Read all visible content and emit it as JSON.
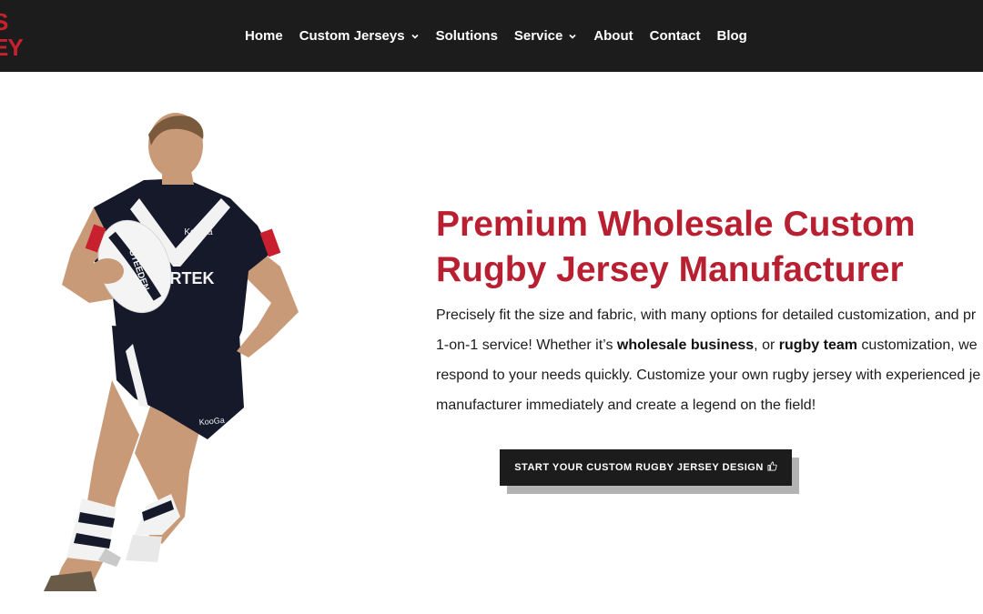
{
  "header": {
    "logo_lines": [
      "S",
      "EY"
    ],
    "nav": [
      {
        "label": "Home",
        "dropdown": false
      },
      {
        "label": "Custom Jerseys",
        "dropdown": true
      },
      {
        "label": "Solutions",
        "dropdown": false
      },
      {
        "label": "Service",
        "dropdown": true
      },
      {
        "label": "About",
        "dropdown": false
      },
      {
        "label": "Contact",
        "dropdown": false
      },
      {
        "label": "Blog",
        "dropdown": false
      }
    ]
  },
  "hero": {
    "title_line1": "Premium Wholesale Custom",
    "title_line2": "Rugby Jersey Manufacturer",
    "desc": {
      "line1": "Precisely fit the size and fabric, with many options for detailed customization, and pr",
      "line2_a": "1-on-1 service! Whether it’s ",
      "line2_b": "wholesale business",
      "line2_c": ", or ",
      "line2_d": "rugby team",
      "line2_e": " customization, we",
      "line3": "respond to your needs quickly. Customize your own rugby jersey with experienced je",
      "line4": "manufacturer immediately and create a legend on the field!"
    },
    "cta_label": "START YOUR CUSTOM RUGBY JERSEY DESIGN",
    "cta_icon": "thumbs-up-icon",
    "jersey_text": "KooGa",
    "ball_text": "STEEDEN"
  },
  "colors": {
    "header_bg": "#1c1c1c",
    "accent": "#b81f31",
    "cta_bg": "#1c1c1c",
    "cta_shadow": "#b3b3b3"
  }
}
